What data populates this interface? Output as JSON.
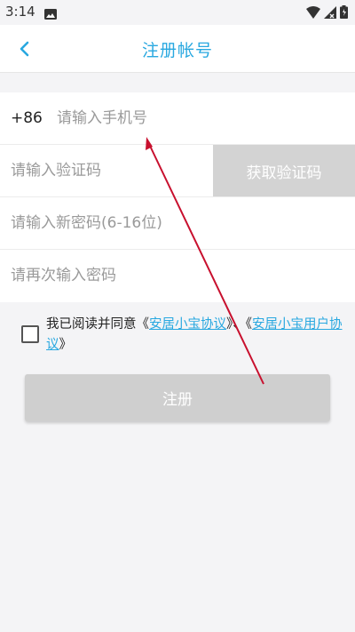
{
  "status_bar": {
    "time": "3:14",
    "icons": [
      "image-icon",
      "wifi-icon",
      "signal-icon",
      "battery-icon"
    ]
  },
  "header": {
    "title": "注册帐号",
    "back_icon": "chevron-left-icon",
    "accent_color": "#29a8e0"
  },
  "form": {
    "phone": {
      "country_code": "+86",
      "placeholder": "请输入手机号",
      "value": ""
    },
    "verification": {
      "placeholder": "请输入验证码",
      "value": "",
      "button_label": "获取验证码"
    },
    "password": {
      "placeholder": "请输入新密码(6-16位)",
      "value": ""
    },
    "confirm_password": {
      "placeholder": "请再次输入密码",
      "value": ""
    }
  },
  "agreement": {
    "checked": false,
    "prefix": "我已阅读并同意《",
    "link1": "安居小宝协议",
    "middle": "》、《",
    "link2": "安居小宝用户协议",
    "suffix": "》"
  },
  "register_button": {
    "label": "注册"
  },
  "annotation": {
    "type": "arrow",
    "color": "#c8102e",
    "points_to": "phone-input"
  }
}
